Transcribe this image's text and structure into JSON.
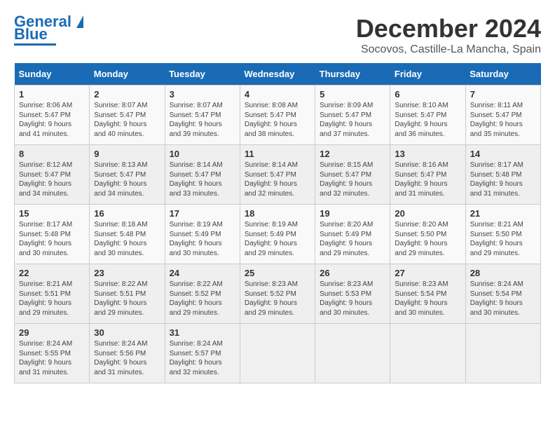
{
  "header": {
    "logo_text1": "General",
    "logo_text2": "Blue",
    "month": "December 2024",
    "location": "Socovos, Castille-La Mancha, Spain"
  },
  "weekdays": [
    "Sunday",
    "Monday",
    "Tuesday",
    "Wednesday",
    "Thursday",
    "Friday",
    "Saturday"
  ],
  "weeks": [
    [
      {
        "day": "1",
        "info": "Sunrise: 8:06 AM\nSunset: 5:47 PM\nDaylight: 9 hours\nand 41 minutes."
      },
      {
        "day": "2",
        "info": "Sunrise: 8:07 AM\nSunset: 5:47 PM\nDaylight: 9 hours\nand 40 minutes."
      },
      {
        "day": "3",
        "info": "Sunrise: 8:07 AM\nSunset: 5:47 PM\nDaylight: 9 hours\nand 39 minutes."
      },
      {
        "day": "4",
        "info": "Sunrise: 8:08 AM\nSunset: 5:47 PM\nDaylight: 9 hours\nand 38 minutes."
      },
      {
        "day": "5",
        "info": "Sunrise: 8:09 AM\nSunset: 5:47 PM\nDaylight: 9 hours\nand 37 minutes."
      },
      {
        "day": "6",
        "info": "Sunrise: 8:10 AM\nSunset: 5:47 PM\nDaylight: 9 hours\nand 36 minutes."
      },
      {
        "day": "7",
        "info": "Sunrise: 8:11 AM\nSunset: 5:47 PM\nDaylight: 9 hours\nand 35 minutes."
      }
    ],
    [
      {
        "day": "8",
        "info": "Sunrise: 8:12 AM\nSunset: 5:47 PM\nDaylight: 9 hours\nand 34 minutes."
      },
      {
        "day": "9",
        "info": "Sunrise: 8:13 AM\nSunset: 5:47 PM\nDaylight: 9 hours\nand 34 minutes."
      },
      {
        "day": "10",
        "info": "Sunrise: 8:14 AM\nSunset: 5:47 PM\nDaylight: 9 hours\nand 33 minutes."
      },
      {
        "day": "11",
        "info": "Sunrise: 8:14 AM\nSunset: 5:47 PM\nDaylight: 9 hours\nand 32 minutes."
      },
      {
        "day": "12",
        "info": "Sunrise: 8:15 AM\nSunset: 5:47 PM\nDaylight: 9 hours\nand 32 minutes."
      },
      {
        "day": "13",
        "info": "Sunrise: 8:16 AM\nSunset: 5:47 PM\nDaylight: 9 hours\nand 31 minutes."
      },
      {
        "day": "14",
        "info": "Sunrise: 8:17 AM\nSunset: 5:48 PM\nDaylight: 9 hours\nand 31 minutes."
      }
    ],
    [
      {
        "day": "15",
        "info": "Sunrise: 8:17 AM\nSunset: 5:48 PM\nDaylight: 9 hours\nand 30 minutes."
      },
      {
        "day": "16",
        "info": "Sunrise: 8:18 AM\nSunset: 5:48 PM\nDaylight: 9 hours\nand 30 minutes."
      },
      {
        "day": "17",
        "info": "Sunrise: 8:19 AM\nSunset: 5:49 PM\nDaylight: 9 hours\nand 30 minutes."
      },
      {
        "day": "18",
        "info": "Sunrise: 8:19 AM\nSunset: 5:49 PM\nDaylight: 9 hours\nand 29 minutes."
      },
      {
        "day": "19",
        "info": "Sunrise: 8:20 AM\nSunset: 5:49 PM\nDaylight: 9 hours\nand 29 minutes."
      },
      {
        "day": "20",
        "info": "Sunrise: 8:20 AM\nSunset: 5:50 PM\nDaylight: 9 hours\nand 29 minutes."
      },
      {
        "day": "21",
        "info": "Sunrise: 8:21 AM\nSunset: 5:50 PM\nDaylight: 9 hours\nand 29 minutes."
      }
    ],
    [
      {
        "day": "22",
        "info": "Sunrise: 8:21 AM\nSunset: 5:51 PM\nDaylight: 9 hours\nand 29 minutes."
      },
      {
        "day": "23",
        "info": "Sunrise: 8:22 AM\nSunset: 5:51 PM\nDaylight: 9 hours\nand 29 minutes."
      },
      {
        "day": "24",
        "info": "Sunrise: 8:22 AM\nSunset: 5:52 PM\nDaylight: 9 hours\nand 29 minutes."
      },
      {
        "day": "25",
        "info": "Sunrise: 8:23 AM\nSunset: 5:52 PM\nDaylight: 9 hours\nand 29 minutes."
      },
      {
        "day": "26",
        "info": "Sunrise: 8:23 AM\nSunset: 5:53 PM\nDaylight: 9 hours\nand 30 minutes."
      },
      {
        "day": "27",
        "info": "Sunrise: 8:23 AM\nSunset: 5:54 PM\nDaylight: 9 hours\nand 30 minutes."
      },
      {
        "day": "28",
        "info": "Sunrise: 8:24 AM\nSunset: 5:54 PM\nDaylight: 9 hours\nand 30 minutes."
      }
    ],
    [
      {
        "day": "29",
        "info": "Sunrise: 8:24 AM\nSunset: 5:55 PM\nDaylight: 9 hours\nand 31 minutes."
      },
      {
        "day": "30",
        "info": "Sunrise: 8:24 AM\nSunset: 5:56 PM\nDaylight: 9 hours\nand 31 minutes."
      },
      {
        "day": "31",
        "info": "Sunrise: 8:24 AM\nSunset: 5:57 PM\nDaylight: 9 hours\nand 32 minutes."
      },
      {
        "day": "",
        "info": ""
      },
      {
        "day": "",
        "info": ""
      },
      {
        "day": "",
        "info": ""
      },
      {
        "day": "",
        "info": ""
      }
    ]
  ]
}
